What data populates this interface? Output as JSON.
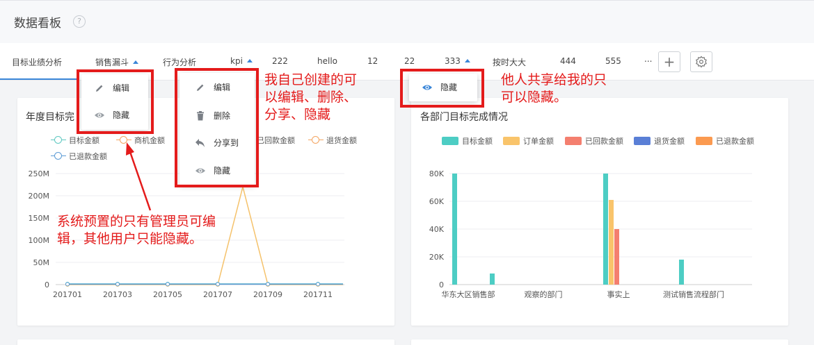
{
  "header": {
    "title": "数据看板",
    "help_icon": "question-circle-icon"
  },
  "tabs": [
    {
      "label": "目标业绩分析",
      "active": true,
      "caret": false
    },
    {
      "label": "销售漏斗",
      "active": false,
      "caret": true
    },
    {
      "label": "行为分析",
      "active": false,
      "caret": false
    },
    {
      "label": "kpi",
      "active": false,
      "caret": true
    },
    {
      "label": "222",
      "active": false,
      "caret": false
    },
    {
      "label": "hello",
      "active": false,
      "caret": false
    },
    {
      "label": "12",
      "active": false,
      "caret": false
    },
    {
      "label": "22",
      "active": false,
      "caret": false
    },
    {
      "label": "333",
      "active": false,
      "caret": true
    },
    {
      "label": "按时大大",
      "active": false,
      "caret": false
    },
    {
      "label": "444",
      "active": false,
      "caret": false
    },
    {
      "label": "555",
      "active": false,
      "caret": false
    }
  ],
  "toolbar": {
    "more_label": "...",
    "add_icon": "plus-icon",
    "settings_icon": "gear-icon"
  },
  "menus": {
    "system": [
      {
        "icon": "pencil-icon",
        "label": "编辑"
      },
      {
        "icon": "eye-icon",
        "label": "隐藏"
      }
    ],
    "own": [
      {
        "icon": "pencil-icon",
        "label": "编辑"
      },
      {
        "icon": "trash-icon",
        "label": "删除"
      },
      {
        "icon": "share-icon",
        "label": "分享到"
      },
      {
        "icon": "eye-icon",
        "label": "隐藏"
      }
    ],
    "shared": [
      {
        "icon": "eye-icon",
        "label": "隐藏"
      }
    ]
  },
  "annotations": {
    "own": [
      "我自己创建的可",
      "以编辑、删除、",
      "分享、隐藏"
    ],
    "shared": [
      "他人共享给我的只",
      "可以隐藏。"
    ],
    "system": [
      "系统预置的只有管理员可编",
      "辑，其他用户只能隐藏。"
    ]
  },
  "colors": {
    "accent": "#3a86d8",
    "annotation_red": "#e41b1b"
  },
  "chart_data": [
    {
      "type": "line",
      "title": "年度目标完",
      "legend": [
        {
          "name": "目标金额",
          "color": "#5dc8c0"
        },
        {
          "name": "商机金额",
          "color": "#f4a460"
        },
        {
          "name": "已回款金额",
          "color": "#f4a460"
        },
        {
          "name": "退货金额",
          "color": "#f4a460"
        },
        {
          "name": "已退款金额",
          "color": "#5b9bd5"
        }
      ],
      "y_ticks": [
        "250M",
        "200M",
        "150M",
        "100M",
        "50M",
        "0"
      ],
      "ylim": [
        0,
        250
      ],
      "x_tick_labels": [
        "201701",
        "201703",
        "201705",
        "201707",
        "201709",
        "201711"
      ],
      "x": [
        1,
        2,
        3,
        4,
        5,
        6,
        7,
        8,
        9,
        10,
        11,
        12
      ],
      "series": [
        {
          "name": "目标金额",
          "color": "#5dc8c0",
          "values": [
            1.5,
            1.5,
            1.5,
            1.5,
            1.5,
            1.5,
            1.5,
            1.5,
            1.5,
            1.5,
            1.5,
            1.5
          ]
        },
        {
          "name": "商机金额",
          "color": "#f5c26b",
          "values": [
            0,
            0,
            0,
            0,
            0,
            0,
            0,
            220,
            0,
            0,
            0,
            0
          ]
        },
        {
          "name": "已退款金额",
          "color": "#5b9bd5",
          "values": [
            1,
            1,
            1,
            1,
            1,
            1,
            1,
            1,
            1,
            1,
            1,
            1
          ]
        }
      ]
    },
    {
      "type": "bar",
      "title": "各部门目标完成情况",
      "legend": [
        {
          "name": "目标金额",
          "color": "#4dcdc4"
        },
        {
          "name": "订单金额",
          "color": "#f9c46b"
        },
        {
          "name": "已回款金额",
          "color": "#f47f6f"
        },
        {
          "name": "退货金额",
          "color": "#5a7fd6"
        },
        {
          "name": "已退款金额",
          "color": "#fb9a50"
        }
      ],
      "y_ticks": [
        "80K",
        "60K",
        "40K",
        "20K",
        "0"
      ],
      "ylim": [
        0,
        80000
      ],
      "x_tick_labels": [
        "华东大区销售部",
        "观察的部门",
        "事实上",
        "测试销售流程部门"
      ],
      "bars": [
        {
          "slot": 0,
          "series": 0,
          "value": 80000
        },
        {
          "slot": 1,
          "series": 0,
          "value": 8000
        },
        {
          "slot": 3,
          "series": 0,
          "value": 80000
        },
        {
          "slot": 3,
          "series": 1,
          "value": 61000
        },
        {
          "slot": 3,
          "series": 2,
          "value": 40000
        },
        {
          "slot": 4,
          "series": 0,
          "value": 18000
        }
      ]
    }
  ]
}
